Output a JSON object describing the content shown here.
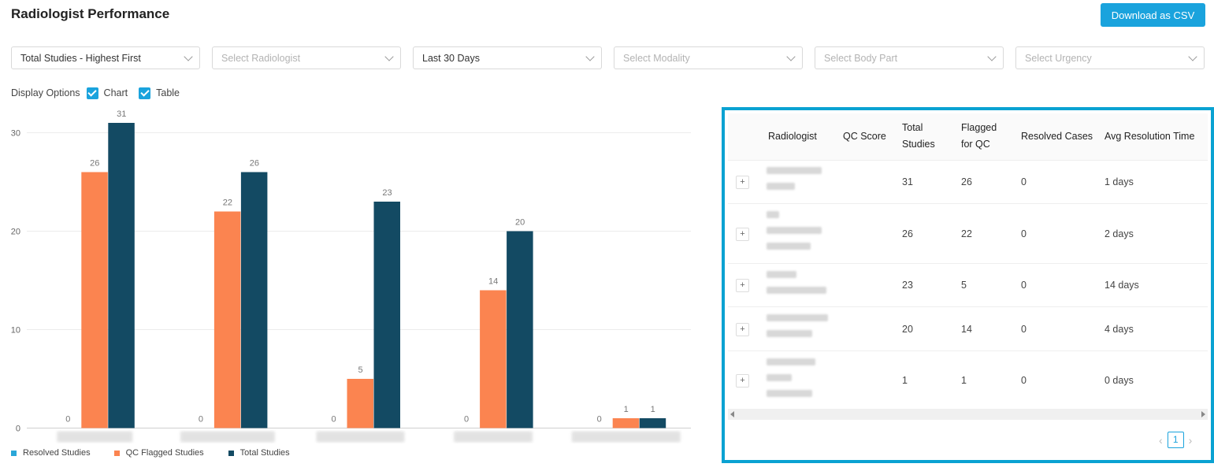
{
  "header": {
    "title": "Radiologist Performance",
    "download_label": "Download as CSV"
  },
  "filters": [
    {
      "value": "Total Studies - Highest First",
      "placeholder": false
    },
    {
      "value": "Select Radiologist",
      "placeholder": true
    },
    {
      "value": "Last 30 Days",
      "placeholder": false
    },
    {
      "value": "Select Modality",
      "placeholder": true
    },
    {
      "value": "Select Body Part",
      "placeholder": true
    },
    {
      "value": "Select Urgency",
      "placeholder": true
    }
  ],
  "display_options": {
    "label": "Display Options",
    "chart_label": "Chart",
    "table_label": "Table"
  },
  "chart_data": {
    "type": "bar",
    "categories": [
      "",
      "",
      "",
      "",
      ""
    ],
    "series": [
      {
        "name": "Resolved Studies",
        "values": [
          0,
          0,
          0,
          0,
          0
        ],
        "color": "#2aa7d8"
      },
      {
        "name": "QC Flagged Studies",
        "values": [
          26,
          22,
          5,
          14,
          1
        ],
        "color": "#fb8450"
      },
      {
        "name": "Total Studies",
        "values": [
          31,
          26,
          23,
          20,
          1
        ],
        "color": "#134a63"
      }
    ],
    "yticks": [
      0,
      10,
      20,
      30
    ],
    "ylim": [
      0,
      31
    ],
    "grid": true,
    "legend_position": "bottom-left",
    "xlabel": "",
    "ylabel": ""
  },
  "table": {
    "headers": {
      "radiologist": "Radiologist",
      "qc_score": "QC Score",
      "total_studies": "Total Studies",
      "flagged": "Flagged for QC",
      "resolved": "Resolved Cases",
      "avg_time": "Avg Resolution Time"
    },
    "rows": [
      {
        "total": "31",
        "flagged": "26",
        "resolved": "0",
        "avg_time": "1 days"
      },
      {
        "total": "26",
        "flagged": "22",
        "resolved": "0",
        "avg_time": "2 days"
      },
      {
        "total": "23",
        "flagged": "5",
        "resolved": "0",
        "avg_time": "14 days"
      },
      {
        "total": "20",
        "flagged": "14",
        "resolved": "0",
        "avg_time": "4 days"
      },
      {
        "total": "1",
        "flagged": "1",
        "resolved": "0",
        "avg_time": "0 days"
      }
    ],
    "expand_symbol": "+",
    "current_page": "1"
  }
}
